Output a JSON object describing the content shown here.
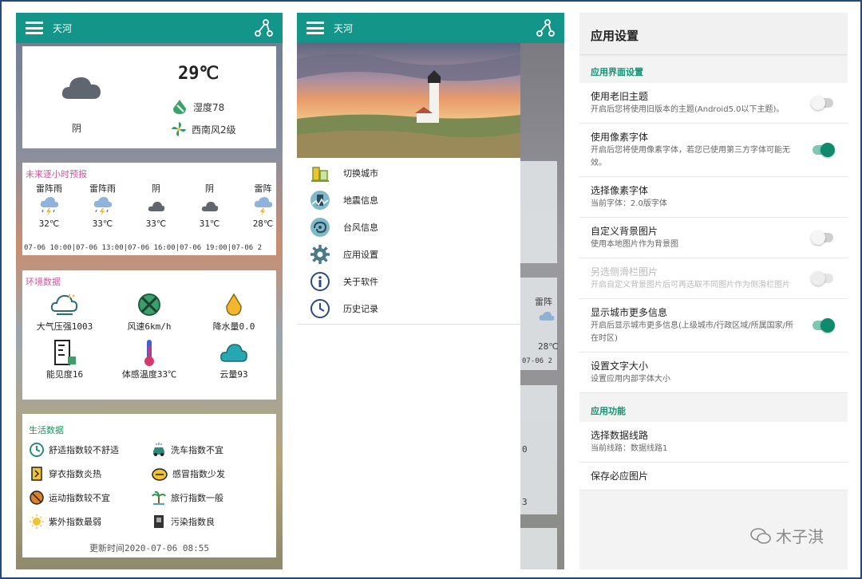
{
  "app": {
    "city": "天河"
  },
  "now": {
    "desc": "阴",
    "temp": "29℃",
    "humidity": "湿度78",
    "wind": "西南风2级"
  },
  "hourly": {
    "title": "未来逐小时预报",
    "items": [
      {
        "desc": "雷阵雨",
        "icon": "thunder-rain-icon",
        "temp": "32℃"
      },
      {
        "desc": "雷阵雨",
        "icon": "thunder-rain-icon",
        "temp": "33℃"
      },
      {
        "desc": "阴",
        "icon": "cloud-icon",
        "temp": "33℃"
      },
      {
        "desc": "阴",
        "icon": "cloud-icon",
        "temp": "31℃"
      },
      {
        "desc": "雷阵",
        "icon": "thunder-rain-icon",
        "temp": "28℃"
      }
    ],
    "times": "07-06 10:00|07-06 13:00|07-06 16:00|07-06 19:00|07-06 2"
  },
  "env": {
    "title": "环境数据",
    "items": [
      {
        "label": "大气压强1003",
        "icon": "pressure-cloud-icon"
      },
      {
        "label": "风速6km/h",
        "icon": "fan-icon"
      },
      {
        "label": "降水量0.0",
        "icon": "raindrop-icon"
      },
      {
        "label": "能见度16",
        "icon": "visibility-chart-icon"
      },
      {
        "label": "体感温度33℃",
        "icon": "thermometer-icon"
      },
      {
        "label": "云量93",
        "icon": "cloud-cover-icon"
      }
    ]
  },
  "life": {
    "title": "生活数据",
    "items": [
      {
        "label": "舒适指数较不舒适",
        "icon": "comfort-clock-icon"
      },
      {
        "label": "洗车指数不宜",
        "icon": "car-wash-icon"
      },
      {
        "label": "穿衣指数炎热",
        "icon": "clothing-icon"
      },
      {
        "label": "感冒指数少发",
        "icon": "cold-pill-icon"
      },
      {
        "label": "运动指数较不宜",
        "icon": "sport-ball-icon"
      },
      {
        "label": "旅行指数一般",
        "icon": "travel-palm-icon"
      },
      {
        "label": "紫外指数最弱",
        "icon": "sun-icon"
      },
      {
        "label": "污染指数良",
        "icon": "pollution-icon"
      }
    ],
    "update": "更新时间2020-07-06 08:55"
  },
  "drawer": {
    "menu": [
      {
        "label": "切换城市",
        "icon": "city-icon"
      },
      {
        "label": "地震信息",
        "icon": "earthquake-icon"
      },
      {
        "label": "台风信息",
        "icon": "typhoon-icon"
      },
      {
        "label": "应用设置",
        "icon": "settings-gear-icon"
      },
      {
        "label": "关于软件",
        "icon": "info-icon"
      },
      {
        "label": "历史记录",
        "icon": "history-clock-icon"
      }
    ],
    "ghost": {
      "desc": "雷阵",
      "temp": "28℃",
      "time": "07-06 2",
      "value": "0",
      "extra": "3"
    }
  },
  "settings": {
    "header": "应用设置",
    "categories": [
      {
        "title": "应用界面设置",
        "items": [
          {
            "title": "使用老旧主题",
            "desc": "开启后您将使用旧版本的主题(Android5.0以下主题)。",
            "toggle": "off"
          },
          {
            "title": "使用像素字体",
            "desc": "开启后您将使用像素字体，若您已使用第三方字体可能无效。",
            "toggle": "on"
          },
          {
            "title": "选择像素字体",
            "desc": "当前字体：2.0版字体",
            "toggle": "none"
          },
          {
            "title": "自定义背景图片",
            "desc": "使用本地图片作为背景图",
            "toggle": "off"
          },
          {
            "title": "另选侧滑栏图片",
            "desc": "开启自定义背景图片后可再选取不同图片作为侧滑栏图片",
            "toggle": "disabled"
          },
          {
            "title": "显示城市更多信息",
            "desc": "开启后显示城市更多信息(上级城市/行政区域/所属国家/所在时区)",
            "toggle": "on"
          },
          {
            "title": "设置文字大小",
            "desc": "设置应用内部字体大小",
            "toggle": "none"
          }
        ]
      },
      {
        "title": "应用功能",
        "items": [
          {
            "title": "选择数据线路",
            "desc": "当前线路：数据线路1",
            "toggle": "none"
          },
          {
            "title": "保存必应图片",
            "desc": "",
            "toggle": "none"
          }
        ]
      }
    ]
  },
  "watermark": "木子淇",
  "colors": {
    "appbar": "#14958a",
    "accent_green": "#0f8a6c",
    "section_pink": "#d0569a"
  }
}
